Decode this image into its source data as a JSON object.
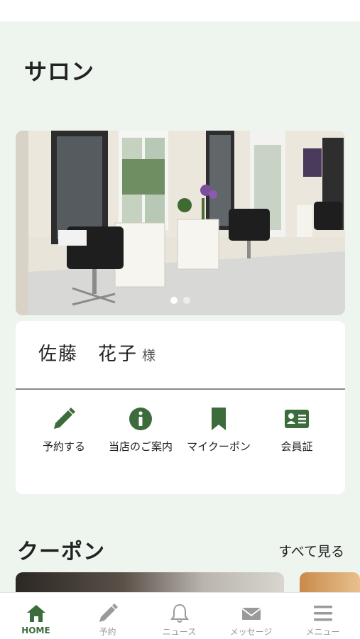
{
  "colors": {
    "accent": "#3c6b3c",
    "background": "#eef5ef",
    "tab_inactive": "#9a9a9a"
  },
  "salon_section": {
    "title": "サロン",
    "carousel": {
      "slide_count": 2,
      "active_index": 0
    }
  },
  "member": {
    "name": "佐藤　花子",
    "suffix": "様"
  },
  "actions": [
    {
      "label": "予約する",
      "icon": "pencil-icon"
    },
    {
      "label": "当店のご案内",
      "icon": "info-icon"
    },
    {
      "label": "マイクーポン",
      "icon": "bookmark-icon"
    },
    {
      "label": "会員証",
      "icon": "id-card-icon"
    }
  ],
  "coupon_section": {
    "title": "クーポン",
    "see_all": "すべて見る"
  },
  "tabbar": [
    {
      "label": "HOME",
      "icon": "home-icon",
      "active": true
    },
    {
      "label": "予約",
      "icon": "pencil-icon",
      "active": false
    },
    {
      "label": "ニュース",
      "icon": "bell-icon",
      "active": false
    },
    {
      "label": "メッセージ",
      "icon": "envelope-icon",
      "active": false
    },
    {
      "label": "メニュー",
      "icon": "menu-icon",
      "active": false
    }
  ]
}
